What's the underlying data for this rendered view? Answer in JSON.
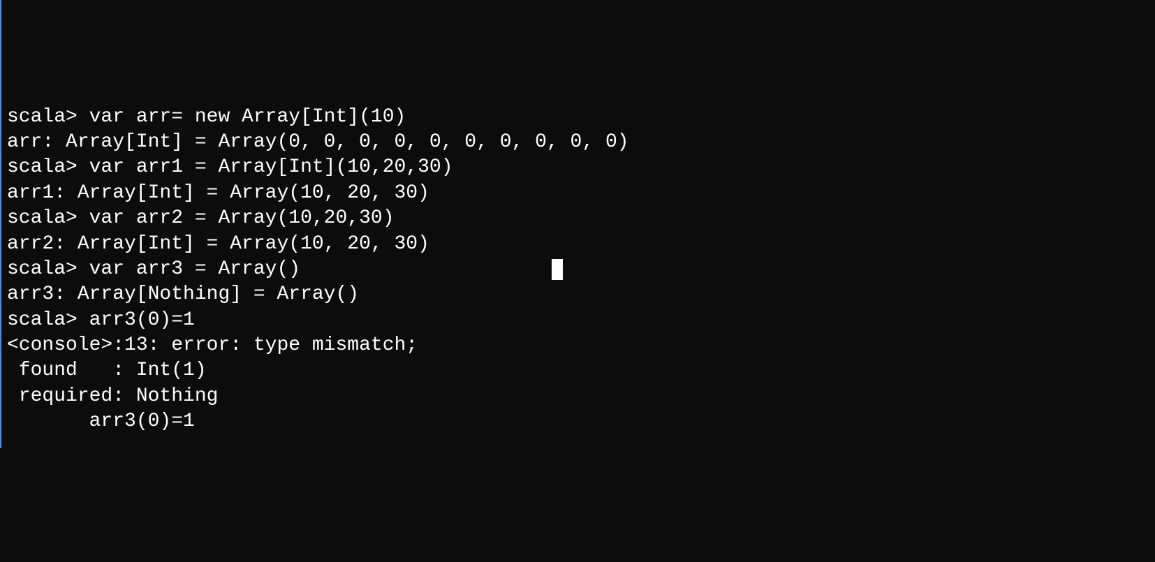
{
  "terminal": {
    "lines": [
      "scala> var arr= new Array[Int](10)",
      "arr: Array[Int] = Array(0, 0, 0, 0, 0, 0, 0, 0, 0, 0)",
      "",
      "scala> var arr1 = Array[Int](10,20,30)",
      "arr1: Array[Int] = Array(10, 20, 30)",
      "",
      "scala> var arr2 = Array(10,20,30)",
      "arr2: Array[Int] = Array(10, 20, 30)",
      "",
      "scala> var arr3 = Array()",
      "arr3: Array[Nothing] = Array()",
      "",
      "scala> arr3(0)=1",
      "<console>:13: error: type mismatch;",
      " found   : Int(1)",
      " required: Nothing",
      "       arr3(0)=1"
    ],
    "cursor_line_index": 9
  }
}
